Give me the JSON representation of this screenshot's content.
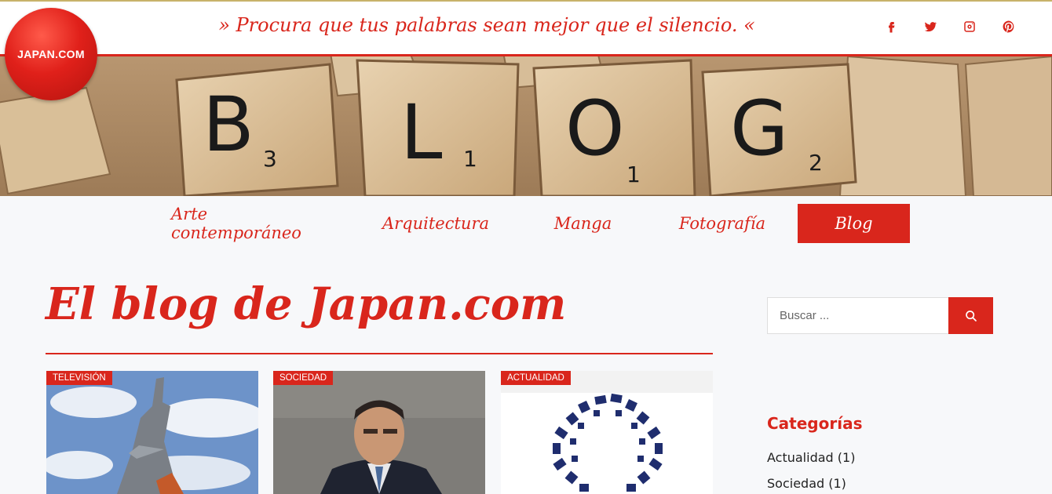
{
  "header": {
    "quote": "» Procura que tus palabras sean mejor que el silencio. «",
    "logo_text": "JAPAN.COM",
    "social": [
      {
        "icon": "facebook-icon",
        "glyph": "f"
      },
      {
        "icon": "twitter-icon",
        "glyph": "t"
      },
      {
        "icon": "instagram-icon",
        "glyph": "ig"
      },
      {
        "icon": "pinterest-icon",
        "glyph": "p"
      }
    ]
  },
  "banner": {
    "tiles": [
      {
        "letter": "B",
        "score": "3"
      },
      {
        "letter": "L",
        "score": "1"
      },
      {
        "letter": "O",
        "score": "1"
      },
      {
        "letter": "G",
        "score": "2"
      }
    ]
  },
  "nav": {
    "items": [
      {
        "label": "Arte contemporáneo"
      },
      {
        "label": "Arquitectura"
      },
      {
        "label": "Manga"
      },
      {
        "label": "Fotografía"
      },
      {
        "label": "Blog"
      }
    ]
  },
  "main": {
    "title": "El blog de Japan.com",
    "cards": [
      {
        "tag": "TELEVISIÓN"
      },
      {
        "tag": "SOCIEDAD"
      },
      {
        "tag": "ACTUALIDAD"
      }
    ]
  },
  "sidebar": {
    "search_placeholder": "Buscar ...",
    "categories_title": "Categorías",
    "categories": [
      {
        "label": "Actualidad (1)"
      },
      {
        "label": "Sociedad (1)"
      }
    ]
  },
  "colors": {
    "accent": "#d9261c",
    "background": "#f7f8fa"
  }
}
